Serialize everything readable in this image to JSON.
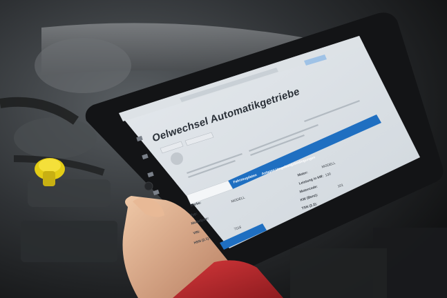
{
  "app": {
    "title": "Oelwechsel Automatikgetriebe"
  },
  "tabs": [
    {
      "label": "Fahrzeugdaten"
    },
    {
      "label": "Anlagen"
    },
    {
      "label": "Umgebungsbedingungen"
    }
  ],
  "vehicle_fields": {
    "marke_label": "Marke:",
    "typ_label": "Typ:",
    "modell_label": "Modelljahr:",
    "vin_label": "VIN:",
    "hsn_label": "HSN (2.1):",
    "modell_value": "MODELL",
    "hsn_value": "7116",
    "motor_label": "Motor:",
    "leistung_label": "Leistung in kW:",
    "motorcode_label": "Motorcode:",
    "kw_label": "KW (Benz):",
    "tsn_label": "TSN (2.2):",
    "motor_value": "MODELL",
    "leistung_value": "130",
    "kw_value": "101"
  },
  "colors": {
    "tab_blue": "#1f6fc1",
    "screen_bg": "#eef1f4",
    "bezel": "#121315",
    "sleeve_red": "#b8262a"
  }
}
